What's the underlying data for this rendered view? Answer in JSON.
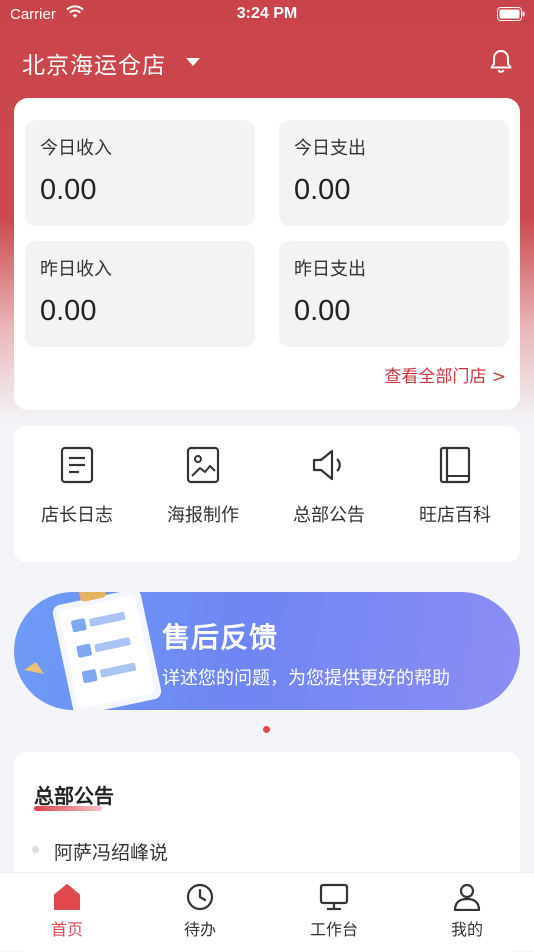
{
  "status_bar": {
    "carrier": "Carrier",
    "time": "3:24 PM"
  },
  "header": {
    "store_name": "北京海运仓店"
  },
  "finance": {
    "today_income_label": "今日收入",
    "today_income_value": "0.00",
    "today_expense_label": "今日支出",
    "today_expense_value": "0.00",
    "yesterday_income_label": "昨日收入",
    "yesterday_income_value": "0.00",
    "yesterday_expense_label": "昨日支出",
    "yesterday_expense_value": "0.00",
    "view_all_link": "查看全部门店 >"
  },
  "menu": {
    "items": [
      {
        "label": "店长日志",
        "icon": "document-icon"
      },
      {
        "label": "海报制作",
        "icon": "image-icon"
      },
      {
        "label": "总部公告",
        "icon": "speaker-icon"
      },
      {
        "label": "旺店百科",
        "icon": "book-icon"
      }
    ]
  },
  "banner": {
    "title": "售后反馈",
    "subtitle": "详述您的问题，为您提供更好的帮助"
  },
  "notices": {
    "title": "总部公告",
    "items": [
      "阿萨冯绍峰说"
    ]
  },
  "tabbar": {
    "items": [
      {
        "label": "首页",
        "icon": "home-icon",
        "active": true
      },
      {
        "label": "待办",
        "icon": "clock-icon",
        "active": false
      },
      {
        "label": "工作台",
        "icon": "monitor-icon",
        "active": false
      },
      {
        "label": "我的",
        "icon": "user-icon",
        "active": false
      }
    ]
  },
  "colors": {
    "primary_red": "#c9444a",
    "active_tab": "#e04a4f",
    "link_red": "#c8393f"
  }
}
